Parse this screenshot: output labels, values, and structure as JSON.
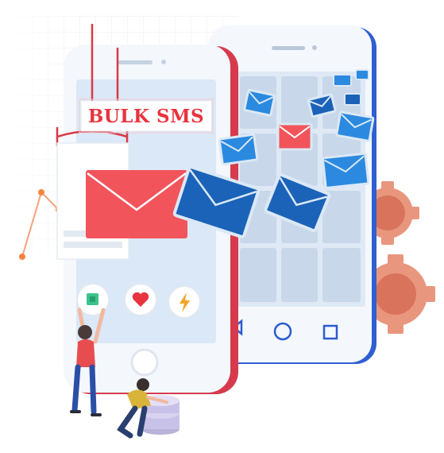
{
  "banner": {
    "title": "BULK SMS"
  },
  "colors": {
    "accent_red": "#e8343f",
    "envelope_red": "#f2545b",
    "envelope_blue": "#1b63b8",
    "envelope_light_blue": "#2b8ae0",
    "phone_front_frame": "#d63b4d",
    "phone_back_frame": "#2f5fd0",
    "screen": "#dde9f7",
    "gear": "#e0876f"
  },
  "icons": {
    "app_icons": [
      "cube-icon",
      "heart-icon",
      "lightning-icon"
    ],
    "nav_icons": [
      "back-triangle-icon",
      "home-circle-icon",
      "recent-square-icon"
    ]
  }
}
